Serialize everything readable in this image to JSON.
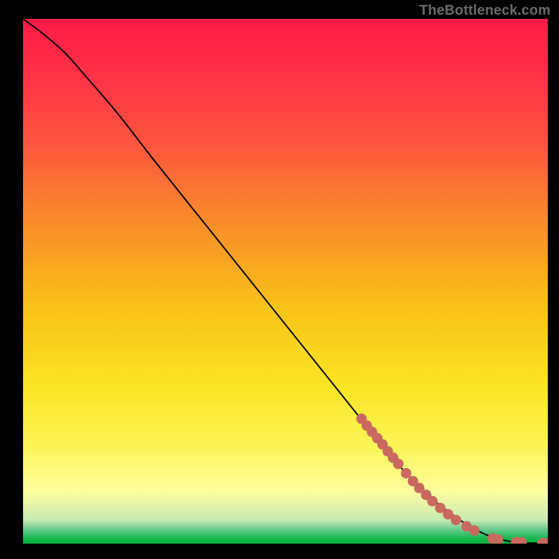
{
  "watermark": "TheBottleneck.com",
  "colors": {
    "dot": "#c9695f",
    "line": "#000000",
    "frame_bg": "#000000"
  },
  "gradient_stops": [
    {
      "offset": 0.0,
      "color": "#ff1a47"
    },
    {
      "offset": 0.12,
      "color": "#ff3446"
    },
    {
      "offset": 0.25,
      "color": "#fd5a3e"
    },
    {
      "offset": 0.4,
      "color": "#f99028"
    },
    {
      "offset": 0.55,
      "color": "#f9c219"
    },
    {
      "offset": 0.7,
      "color": "#fae423"
    },
    {
      "offset": 0.82,
      "color": "#fcf65a"
    },
    {
      "offset": 0.9,
      "color": "#fefd9f"
    },
    {
      "offset": 0.955,
      "color": "#c8eab2"
    },
    {
      "offset": 0.975,
      "color": "#5ec887"
    },
    {
      "offset": 0.99,
      "color": "#17b74f"
    },
    {
      "offset": 1.0,
      "color": "#05b23b"
    }
  ],
  "chart_data": {
    "type": "line",
    "title": "",
    "xlabel": "",
    "ylabel": "",
    "xlim": [
      0,
      100
    ],
    "ylim": [
      0,
      100
    ],
    "series": [
      {
        "name": "curve",
        "x": [
          0,
          4,
          8,
          12,
          18,
          25,
          35,
          45,
          55,
          65,
          72,
          78,
          84,
          88,
          91,
          93,
          95,
          97,
          100
        ],
        "y": [
          100,
          97,
          93.5,
          89,
          82,
          73,
          60.5,
          48,
          35.5,
          23,
          14.5,
          8.5,
          4,
          1.8,
          0.8,
          0.4,
          0.2,
          0.1,
          0.1
        ]
      }
    ],
    "dots": [
      {
        "x": 64.5,
        "y": 23.8
      },
      {
        "x": 65.5,
        "y": 22.5
      },
      {
        "x": 66.5,
        "y": 21.3
      },
      {
        "x": 67.5,
        "y": 20.1
      },
      {
        "x": 68.5,
        "y": 18.9
      },
      {
        "x": 69.5,
        "y": 17.6
      },
      {
        "x": 70.5,
        "y": 16.4
      },
      {
        "x": 71.5,
        "y": 15.2
      },
      {
        "x": 73.0,
        "y": 13.4
      },
      {
        "x": 74.3,
        "y": 11.9
      },
      {
        "x": 75.5,
        "y": 10.6
      },
      {
        "x": 76.8,
        "y": 9.3
      },
      {
        "x": 78.0,
        "y": 8.1
      },
      {
        "x": 79.5,
        "y": 6.8
      },
      {
        "x": 81.0,
        "y": 5.6
      },
      {
        "x": 82.5,
        "y": 4.5
      },
      {
        "x": 84.5,
        "y": 3.3
      },
      {
        "x": 86.0,
        "y": 2.5
      },
      {
        "x": 89.5,
        "y": 1.0
      },
      {
        "x": 90.5,
        "y": 0.8
      },
      {
        "x": 94.0,
        "y": 0.3
      },
      {
        "x": 95.0,
        "y": 0.25
      },
      {
        "x": 99.0,
        "y": 0.1
      },
      {
        "x": 100.0,
        "y": 0.1
      }
    ]
  }
}
